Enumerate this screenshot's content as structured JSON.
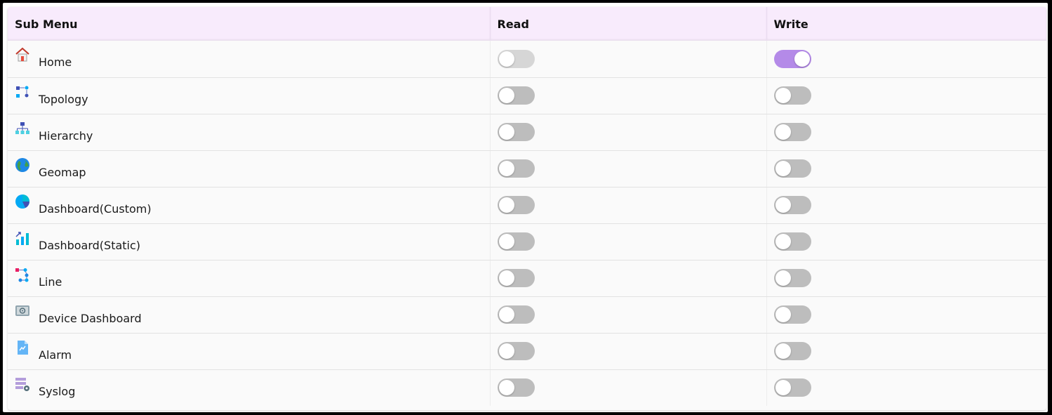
{
  "header": {
    "sub_menu": "Sub Menu",
    "read": "Read",
    "write": "Write"
  },
  "accent_color": "#b48ae8",
  "rows": [
    {
      "label": "Home",
      "icon": "home-icon",
      "read": false,
      "write": true
    },
    {
      "label": "Topology",
      "icon": "topology-icon",
      "read": false,
      "write": false
    },
    {
      "label": "Hierarchy",
      "icon": "hierarchy-icon",
      "read": false,
      "write": false
    },
    {
      "label": "Geomap",
      "icon": "globe-icon",
      "read": false,
      "write": false
    },
    {
      "label": "Dashboard(Custom)",
      "icon": "pie-chart-icon",
      "read": false,
      "write": false
    },
    {
      "label": "Dashboard(Static)",
      "icon": "bar-chart-icon",
      "read": false,
      "write": false
    },
    {
      "label": "Line",
      "icon": "line-flow-icon",
      "read": false,
      "write": false
    },
    {
      "label": "Device Dashboard",
      "icon": "device-icon",
      "read": false,
      "write": false
    },
    {
      "label": "Alarm",
      "icon": "alarm-document-icon",
      "read": false,
      "write": false
    },
    {
      "label": "Syslog",
      "icon": "syslog-gear-icon",
      "read": false,
      "write": false
    }
  ]
}
